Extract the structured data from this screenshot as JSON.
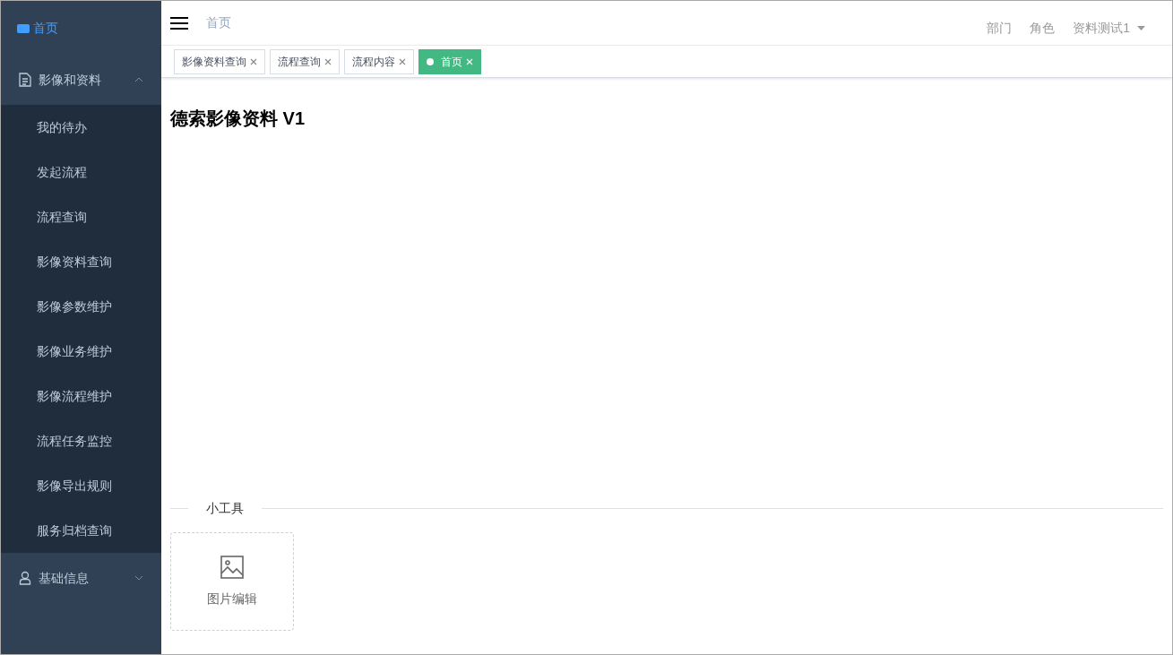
{
  "sidebar": {
    "logo": {
      "label": "首页"
    },
    "menus": [
      {
        "label": "影像和资料",
        "expanded": true,
        "children": [
          {
            "label": "我的待办"
          },
          {
            "label": "发起流程"
          },
          {
            "label": "流程查询"
          },
          {
            "label": "影像资料查询"
          },
          {
            "label": "影像参数维护"
          },
          {
            "label": "影像业务维护"
          },
          {
            "label": "影像流程维护"
          },
          {
            "label": "流程任务监控"
          },
          {
            "label": "影像导出规则"
          },
          {
            "label": "服务归档查询"
          }
        ]
      },
      {
        "label": "基础信息",
        "expanded": false
      }
    ]
  },
  "header": {
    "breadcrumb": "首页",
    "links": [
      "部门",
      "角色"
    ],
    "user": "资料测试1"
  },
  "tabs": [
    {
      "label": "影像资料查询",
      "selected": false
    },
    {
      "label": "流程查询",
      "selected": false
    },
    {
      "label": "流程内容",
      "selected": false
    },
    {
      "label": "首页",
      "selected": true
    }
  ],
  "main": {
    "title": "德索影像资料 V1",
    "section": "小工具",
    "tools": [
      {
        "label": "图片编辑"
      }
    ]
  }
}
